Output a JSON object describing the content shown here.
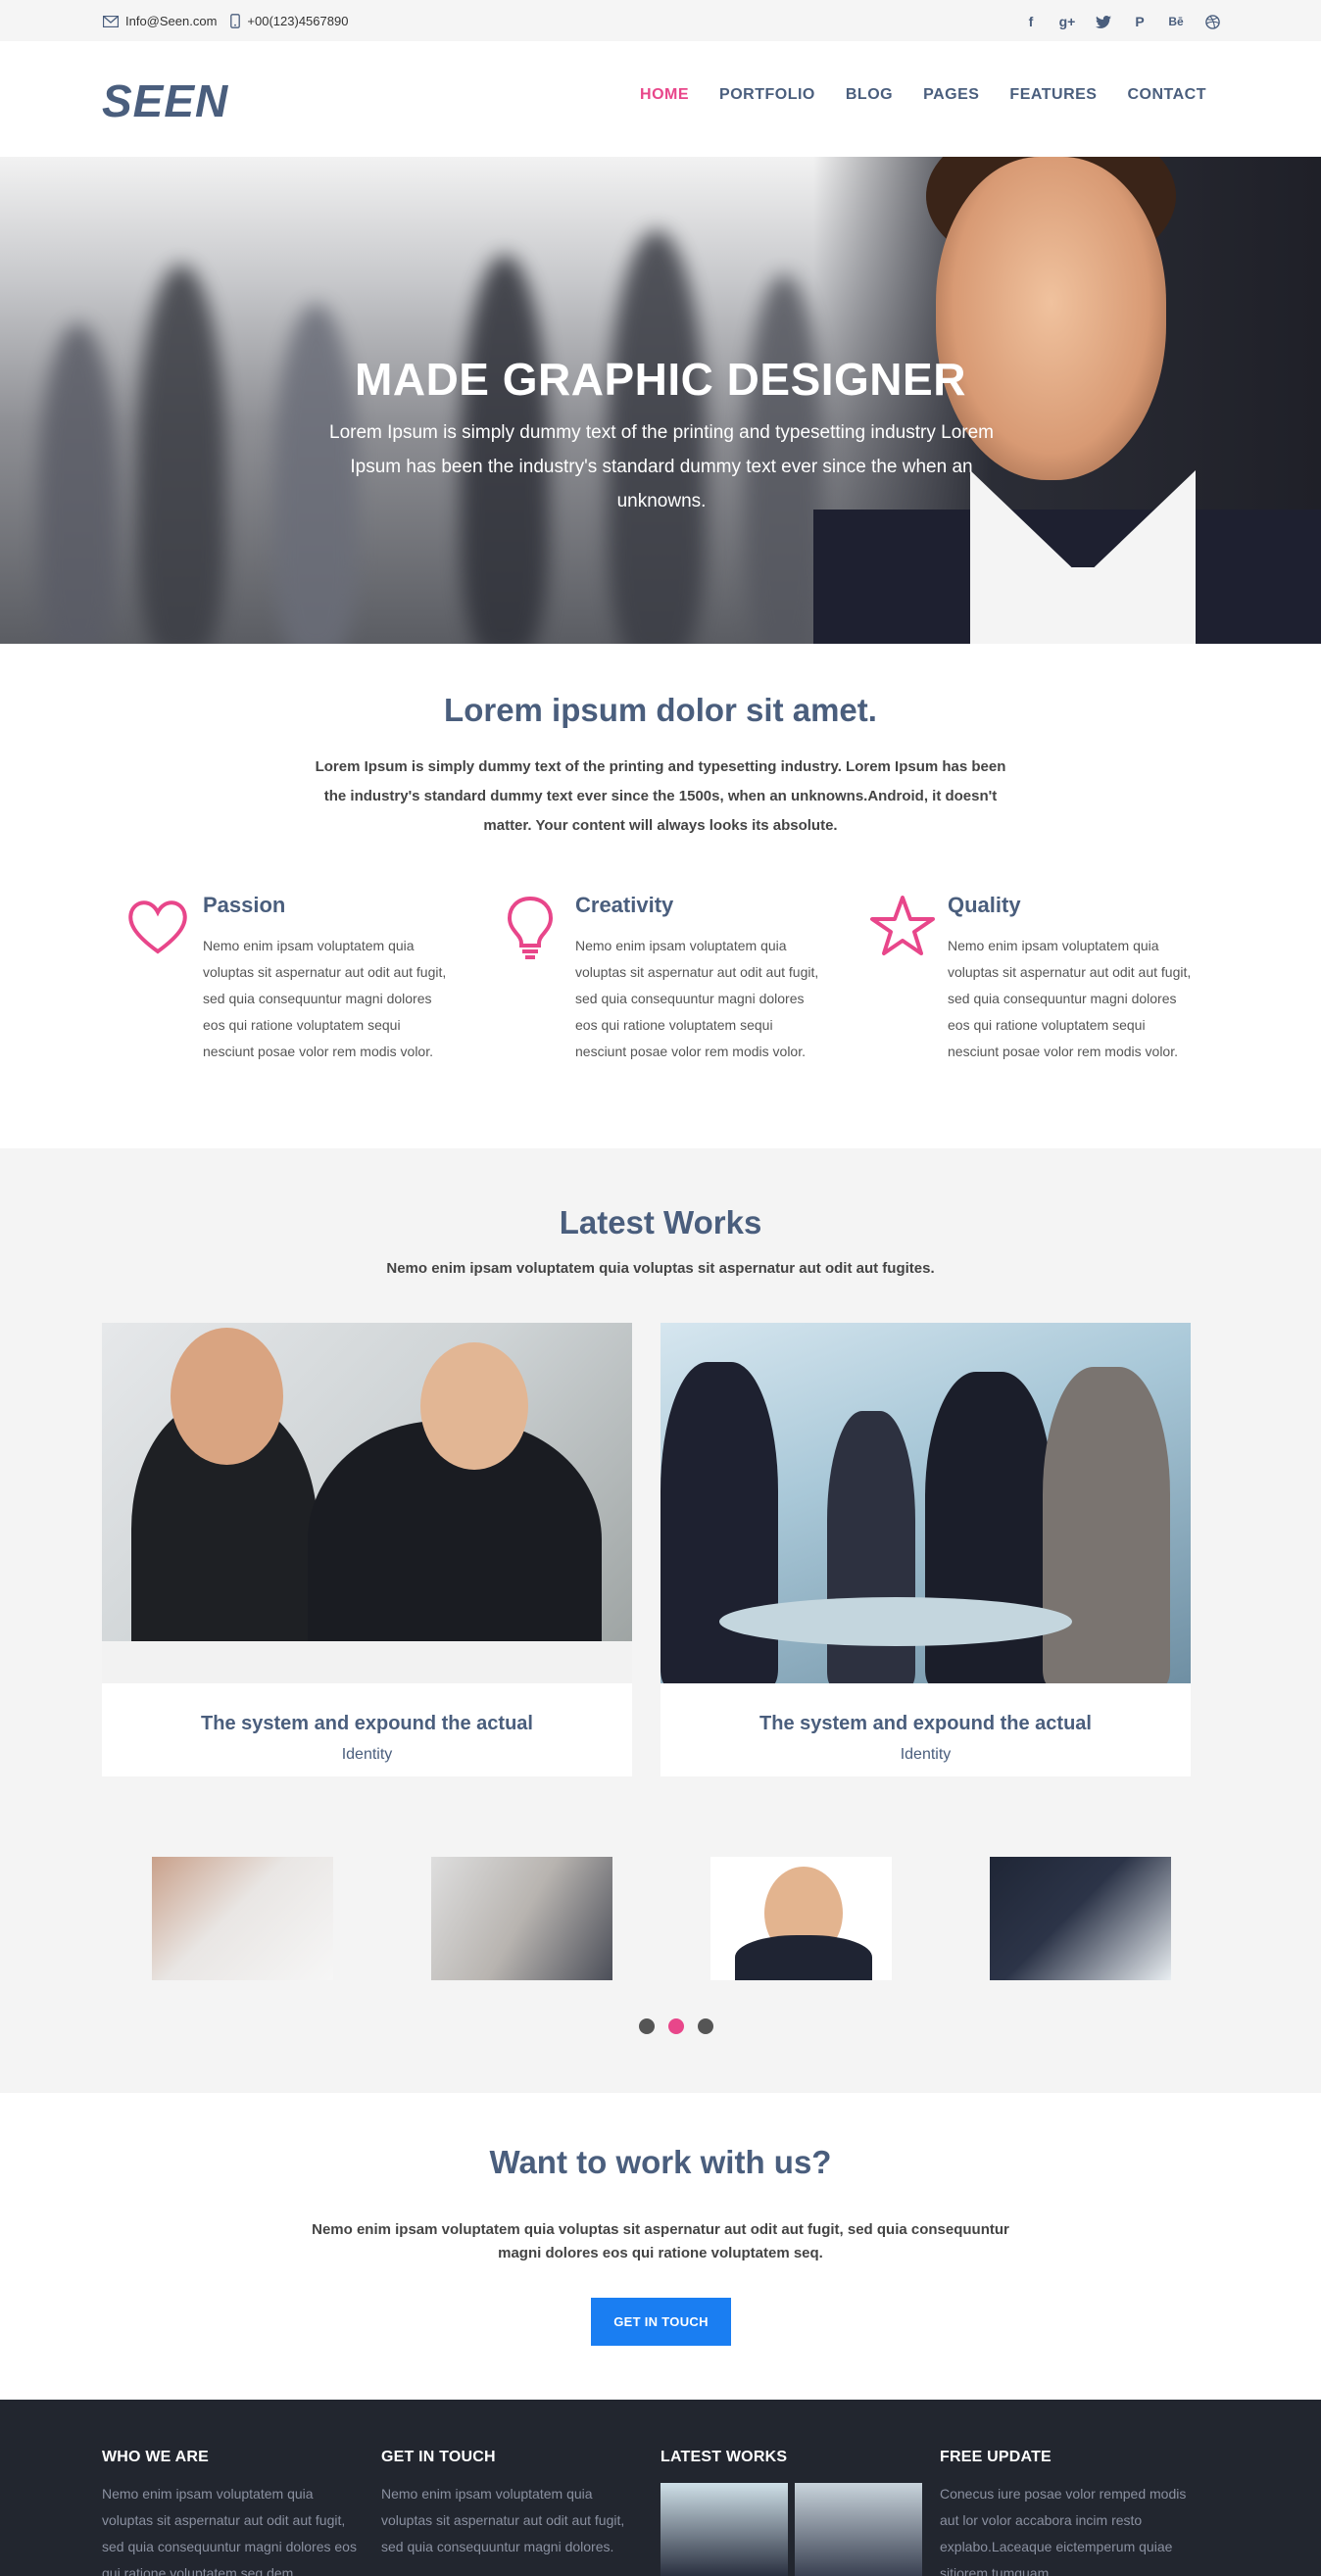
{
  "topbar": {
    "email": "Info@Seen.com",
    "phone": "+00(123)4567890",
    "social": [
      "facebook-icon",
      "google-plus-icon",
      "twitter-icon",
      "pinterest-icon",
      "behance-icon",
      "dribbble-icon"
    ]
  },
  "header": {
    "logo": "SEEN",
    "nav": [
      "HOME",
      "PORTFOLIO",
      "BLOG",
      "PAGES",
      "FEATURES",
      "CONTACT"
    ],
    "active": "HOME"
  },
  "hero": {
    "title": "MADE GRAPHIC DESIGNER",
    "subtitle": "Lorem Ipsum is simply dummy text of the printing and typesetting industry Lorem Ipsum has been the industry's standard dummy text ever since the when an unknowns."
  },
  "intro": {
    "title": "Lorem ipsum dolor sit amet.",
    "text": "Lorem Ipsum is simply dummy text of the printing and typesetting industry. Lorem Ipsum has been the industry's standard dummy text ever since the 1500s, when an unknowns.Android, it doesn't matter. Your content will always looks its absolute."
  },
  "features": [
    {
      "title": "Passion",
      "icon": "heart-icon",
      "text": "Nemo enim ipsam voluptatem quia voluptas sit aspernatur aut odit aut fugit, sed quia consequuntur magni dolores eos qui ratione voluptatem sequi nesciunt posae volor rem modis volor."
    },
    {
      "title": "Creativity",
      "icon": "lightbulb-icon",
      "text": "Nemo enim ipsam voluptatem quia voluptas sit aspernatur aut odit aut fugit, sed quia consequuntur magni dolores eos qui ratione voluptatem sequi nesciunt posae volor rem modis volor."
    },
    {
      "title": "Quality",
      "icon": "star-icon",
      "text": "Nemo enim ipsam voluptatem quia voluptas sit aspernatur aut odit aut fugit, sed quia consequuntur magni dolores eos qui ratione voluptatem sequi nesciunt posae volor rem modis volor."
    }
  ],
  "works": {
    "title": "Latest Works",
    "subtitle": "Nemo enim ipsam voluptatem quia voluptas sit aspernatur aut odit aut fugites.",
    "cards": [
      {
        "title": "The system and expound the actual",
        "category": "Identity"
      },
      {
        "title": "The system and expound the actual",
        "category": "Identity"
      }
    ]
  },
  "cta": {
    "title": "Want to work with us?",
    "text": "Nemo enim ipsam voluptatem quia voluptas sit aspernatur aut odit aut fugit, sed quia consequuntur magni dolores eos qui ratione voluptatem seq.",
    "button": "GET IN TOUCH"
  },
  "footer": {
    "who": {
      "title": "WHO WE ARE",
      "text": "Nemo enim ipsam voluptatem quia voluptas sit aspernatur aut odit aut fugit, sed quia consequuntur magni dolores eos qui ratione voluptatem seq dem"
    },
    "touch": {
      "title": "GET IN TOUCH",
      "text": "Nemo enim ipsam voluptatem quia voluptas sit aspernatur aut odit aut fugit, sed quia consequuntur magni dolores."
    },
    "latest": {
      "title": "LATEST WORKS"
    },
    "update": {
      "title": "FREE UPDATE",
      "text": "Conecus iure posae volor remped modis aut lor volor accabora incim resto explabo.Laceaque eictemperum quiae sitiorem tumquam"
    }
  },
  "colors": {
    "accent": "#e8468a",
    "brand": "#4a5e7d",
    "button": "#1a7ef2",
    "footer": "#22262f"
  }
}
